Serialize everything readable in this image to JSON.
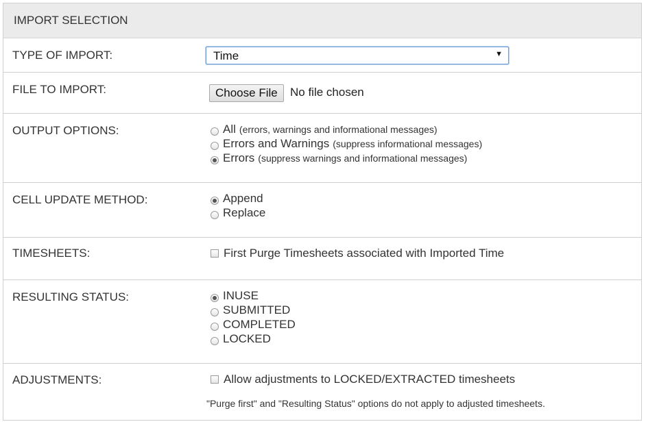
{
  "header": {
    "title": "IMPORT SELECTION"
  },
  "type_of_import": {
    "label": "TYPE OF IMPORT:",
    "selected": "Time"
  },
  "file_to_import": {
    "label": "FILE TO IMPORT:",
    "button": "Choose File",
    "status": "No file chosen"
  },
  "output_options": {
    "label": "OUTPUT OPTIONS:",
    "options": [
      {
        "label": "All",
        "detail": "(errors, warnings and informational messages)",
        "selected": false
      },
      {
        "label": "Errors and Warnings",
        "detail": "(suppress informational messages)",
        "selected": false
      },
      {
        "label": "Errors",
        "detail": "(suppress warnings and informational messages)",
        "selected": true
      }
    ]
  },
  "cell_update_method": {
    "label": "CELL UPDATE METHOD:",
    "options": [
      {
        "label": "Append",
        "selected": true
      },
      {
        "label": "Replace",
        "selected": false
      }
    ]
  },
  "timesheets": {
    "label": "TIMESHEETS:",
    "checkbox": "First Purge Timesheets associated with Imported Time",
    "checked": false
  },
  "resulting_status": {
    "label": "RESULTING STATUS:",
    "options": [
      {
        "label": "INUSE",
        "selected": true
      },
      {
        "label": "SUBMITTED",
        "selected": false
      },
      {
        "label": "COMPLETED",
        "selected": false
      },
      {
        "label": "LOCKED",
        "selected": false
      }
    ]
  },
  "adjustments": {
    "label": "ADJUSTMENTS:",
    "checkbox": "Allow adjustments to LOCKED/EXTRACTED timesheets",
    "checked": false,
    "note": "\"Purge first\" and \"Resulting Status\" options do not apply to adjusted timesheets."
  }
}
